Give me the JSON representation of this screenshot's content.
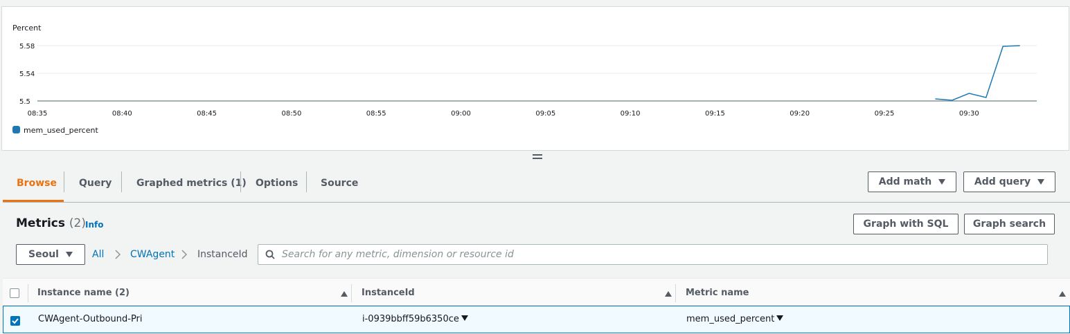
{
  "chart": {
    "legend_label": "mem_used_percent",
    "legend_color": "#1f77b4"
  },
  "chart_data": {
    "type": "line",
    "title": "",
    "ylabel": "Percent",
    "xlabel": "",
    "x_ticks": [
      "08:35",
      "08:40",
      "08:45",
      "08:50",
      "08:55",
      "09:00",
      "09:05",
      "09:10",
      "09:15",
      "09:20",
      "09:25",
      "09:30"
    ],
    "y_ticks": [
      5.5,
      5.54,
      5.58
    ],
    "ylim": [
      5.5,
      5.58
    ],
    "grid": true,
    "legend_position": "bottom-left",
    "series": [
      {
        "name": "mem_used_percent",
        "color": "#1f77b4",
        "x": [
          "09:28",
          "09:29",
          "09:30",
          "09:31",
          "09:32",
          "09:33"
        ],
        "y": [
          5.503,
          5.501,
          5.511,
          5.505,
          5.579,
          5.58
        ]
      }
    ]
  },
  "tabs": [
    {
      "label": "Browse",
      "active": true
    },
    {
      "label": "Query"
    },
    {
      "label": "Graphed metrics (1)"
    },
    {
      "label": "Options"
    },
    {
      "label": "Source"
    }
  ],
  "buttons": {
    "add_math": "Add math",
    "add_query": "Add query",
    "graph_with_sql": "Graph with SQL",
    "graph_search": "Graph search",
    "region": "Seoul"
  },
  "metrics": {
    "title": "Metrics",
    "count": "(2)",
    "info": "Info"
  },
  "breadcrumb": {
    "all": "All",
    "namespace": "CWAgent",
    "dimension": "InstanceId"
  },
  "search": {
    "placeholder": "Search for any metric, dimension or resource id",
    "value": ""
  },
  "table": {
    "headers": [
      "Instance name (2)",
      "InstanceId",
      "Metric name"
    ],
    "rows": [
      {
        "selected": true,
        "instance_name": "CWAgent-Outbound-Pri",
        "instance_id": "i-0939bbff59b6350ce",
        "metric_name": "mem_used_percent"
      }
    ]
  }
}
